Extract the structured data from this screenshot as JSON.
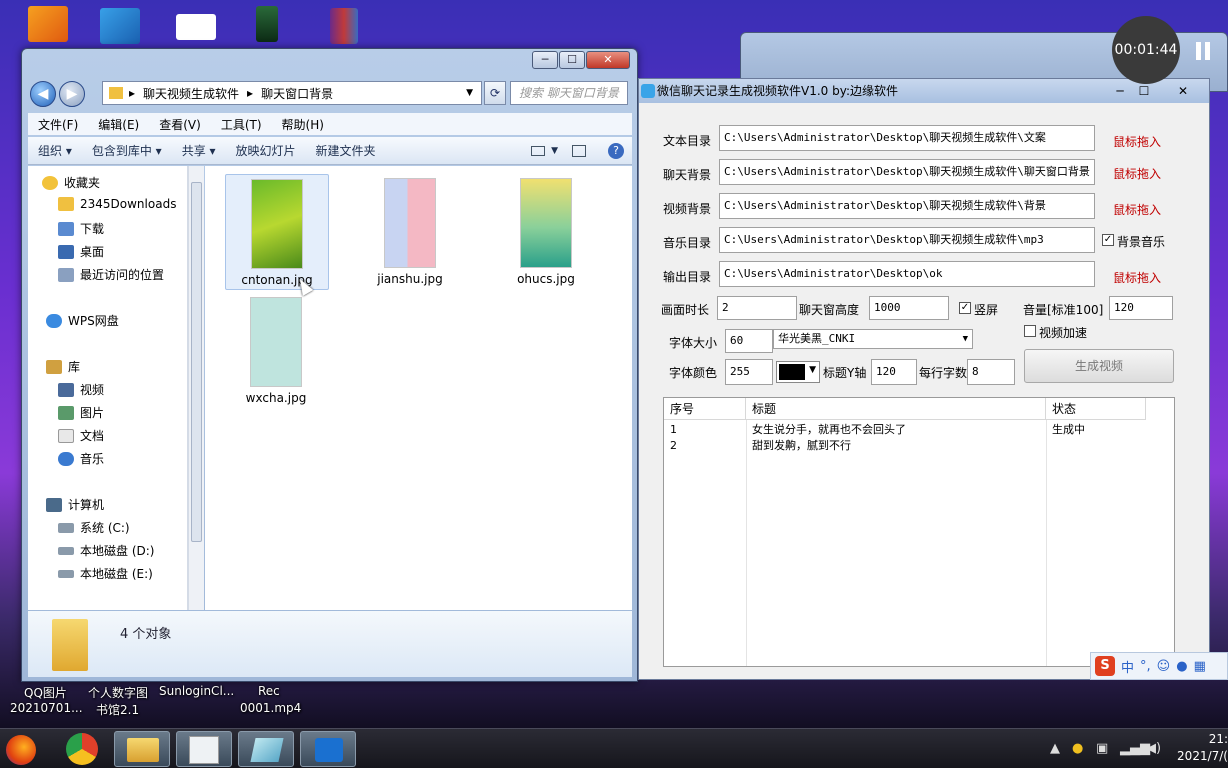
{
  "desktop": {
    "labels": [
      "QQ图片",
      "个人数字图",
      "SunloginCl...",
      "Rec",
      "20210701...",
      "书馆2.1",
      "0001.mp4"
    ]
  },
  "recording": {
    "time": "00:01:44"
  },
  "explorer": {
    "breadcrumb": [
      "聊天视频生成软件",
      "聊天窗口背景"
    ],
    "search_placeholder": "搜索 聊天窗口背景",
    "menu": [
      "文件(F)",
      "编辑(E)",
      "查看(V)",
      "工具(T)",
      "帮助(H)"
    ],
    "toolbar": [
      "组织 ▾",
      "包含到库中 ▾",
      "共享 ▾",
      "放映幻灯片",
      "新建文件夹"
    ],
    "nav": {
      "favorites": "收藏夹",
      "fav_items": [
        "2345Downloads",
        "下载",
        "桌面",
        "最近访问的位置"
      ],
      "wps": "WPS网盘",
      "library": "库",
      "lib_items": [
        "视频",
        "图片",
        "文档",
        "音乐"
      ],
      "computer": "计算机",
      "drives": [
        "系统 (C:)",
        "本地磁盘 (D:)",
        "本地磁盘 (E:)"
      ]
    },
    "files": [
      "cntonan.jpg",
      "jianshu.jpg",
      "ohucs.jpg",
      "wxcha.jpg"
    ],
    "status": "4 个对象"
  },
  "app": {
    "title": "微信聊天记录生成视频软件V1.0 by:边缘软件",
    "paths": [
      {
        "label": "文本目录",
        "value": "C:\\Users\\Administrator\\Desktop\\聊天视频生成软件\\文案",
        "action": "鼠标拖入"
      },
      {
        "label": "聊天背景",
        "value": "C:\\Users\\Administrator\\Desktop\\聊天视频生成软件\\聊天窗口背景",
        "action": "鼠标拖入"
      },
      {
        "label": "视频背景",
        "value": "C:\\Users\\Administrator\\Desktop\\聊天视频生成软件\\背景",
        "action": "鼠标拖入"
      },
      {
        "label": "音乐目录",
        "value": "C:\\Users\\Administrator\\Desktop\\聊天视频生成软件\\mp3",
        "action": "背景音乐"
      },
      {
        "label": "输出目录",
        "value": "C:\\Users\\Administrator\\Desktop\\ok",
        "action": "鼠标拖入"
      }
    ],
    "duration_label": "画面时长",
    "duration": "2",
    "chat_height_label": "聊天窗高度",
    "chat_height": "1000",
    "portrait_label": "竖屏",
    "volume_label": "音量[标准100]",
    "volume": "120",
    "font_size_label": "字体大小",
    "font_size": "60",
    "font_name": "华光美黑_CNKI",
    "speed_label": "视频加速",
    "font_color_label": "字体颜色",
    "font_color": "255",
    "title_y_label": "标题Y轴",
    "title_y": "120",
    "per_line_label": "每行字数",
    "per_line": "8",
    "generate_label": "生成视频",
    "table": {
      "headers": [
        "序号",
        "标题",
        "状态"
      ],
      "rows": [
        [
          "1",
          "女生说分手，就再也不会回头了",
          "生成中"
        ],
        [
          "2",
          "甜到发齁，腻到不行",
          ""
        ]
      ]
    }
  },
  "taskbar": {
    "time": "21:",
    "date": "2021/7/("
  },
  "ime": {
    "label": "中"
  },
  "colors": {
    "accent_red": "#c00000",
    "desktop_purple": "#6a2fd0"
  }
}
